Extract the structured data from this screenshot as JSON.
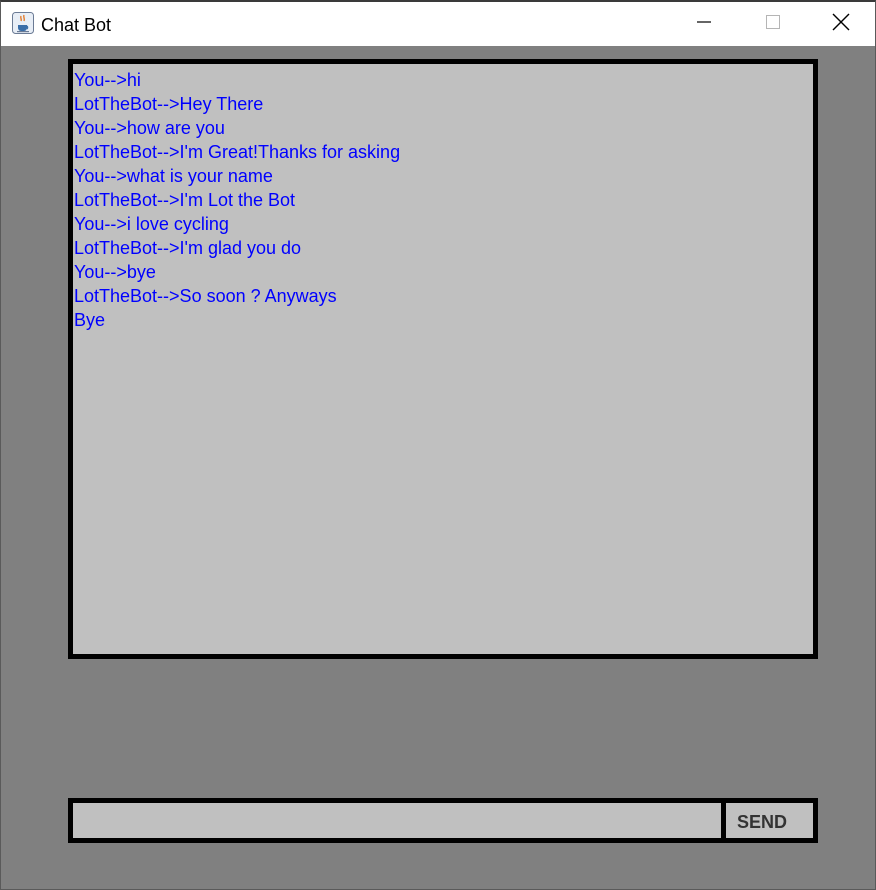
{
  "window": {
    "title": "Chat Bot",
    "icon": "java-coffee-cup-icon",
    "controls": {
      "minimize_icon": "minimize-icon",
      "maximize_icon": "maximize-icon",
      "close_icon": "close-icon"
    }
  },
  "chat": {
    "lines": [
      "You-->hi",
      "LotTheBot-->Hey There",
      "You-->how are you",
      "LotTheBot-->I'm Great!Thanks for asking",
      "You-->what is your name",
      "LotTheBot-->I'm Lot the Bot",
      "You-->i love cycling",
      "LotTheBot-->I'm glad you do",
      "You-->bye",
      "LotTheBot-->So soon ? Anyways",
      "Bye"
    ],
    "text_color": "#0000ff",
    "background": "#c0c0c0"
  },
  "input": {
    "value": "",
    "placeholder": ""
  },
  "send_button": {
    "label": "SEND"
  },
  "colors": {
    "window_background": "#808080",
    "border": "#000000",
    "field_background": "#c0c0c0"
  }
}
